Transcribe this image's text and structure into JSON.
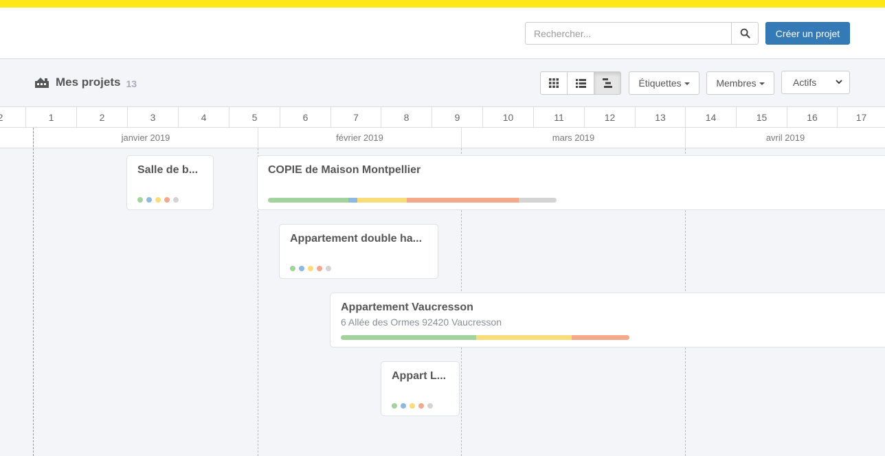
{
  "header": {
    "search_placeholder": "Rechercher...",
    "create_label": "Créer un projet"
  },
  "toolbar": {
    "title": "Mes projets",
    "count": "13",
    "tags_label": "Étiquettes",
    "members_label": "Membres",
    "status_select": {
      "selected": "Actifs",
      "options": [
        "Actifs"
      ]
    }
  },
  "timeline": {
    "weeks": [
      "2",
      "1",
      "2",
      "3",
      "4",
      "5",
      "6",
      "7",
      "8",
      "9",
      "10",
      "11",
      "12",
      "13",
      "14",
      "15",
      "16",
      "17"
    ],
    "months": [
      "janvier 2019",
      "février 2019",
      "mars 2019",
      "avril 2019"
    ]
  },
  "colors": {
    "accent_yellow": "#ffe717",
    "primary_blue": "#337ab7",
    "phase_green": "#a3d39c",
    "phase_blue": "#8fb8e0",
    "phase_yellow": "#fbdc7a",
    "phase_orange": "#f5a88a",
    "phase_grey": "#d4d4d4"
  },
  "projects": [
    {
      "title": "Salle de b...",
      "subtitle": ""
    },
    {
      "title": "COPIE de Maison Montpellier",
      "subtitle": ""
    },
    {
      "title": "Appartement double ha...",
      "subtitle": ""
    },
    {
      "title": "Appartement Vaucresson",
      "subtitle": "6 Allée des Ormes 92420 Vaucresson"
    },
    {
      "title": "Appart L...",
      "subtitle": ""
    }
  ]
}
